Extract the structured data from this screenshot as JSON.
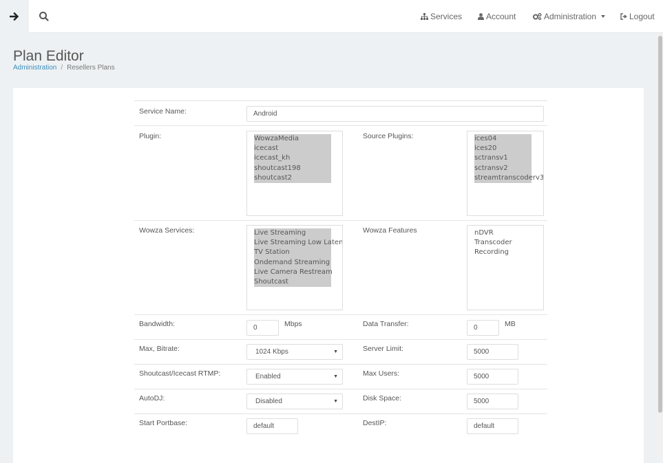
{
  "nav": {
    "services": "Services",
    "account": "Account",
    "administration": "Administration",
    "logout": "Logout"
  },
  "page": {
    "title": "Plan Editor",
    "breadcrumb": [
      "Administration",
      "Resellers Plans"
    ]
  },
  "form": {
    "service_name": {
      "label": "Service Name:",
      "value": "Android"
    },
    "plugin": {
      "label": "Plugin:",
      "options": [
        "WowzaMedia",
        "icecast",
        "icecast_kh",
        "shoutcast198",
        "shoutcast2"
      ]
    },
    "source_plugins": {
      "label": "Source Plugins:",
      "options": [
        "ices04",
        "ices20",
        "sctransv1",
        "sctransv2",
        "streamtranscoderv3"
      ]
    },
    "wowza_services": {
      "label": "Wowza Services:",
      "options": [
        "Live Streaming",
        "Live Streaming Low Latency",
        "TV Station",
        "Ondemand Streaming",
        "Live Camera Restream",
        "Shoutcast"
      ]
    },
    "wowza_features": {
      "label": "Wowza Features",
      "options": [
        "nDVR",
        "Transcoder",
        "Recording"
      ]
    },
    "bandwidth": {
      "label": "Bandwidth:",
      "value": "0",
      "unit": "Mbps"
    },
    "data_transfer": {
      "label": "Data Transfer:",
      "value": "0",
      "unit": "MB"
    },
    "max_bitrate": {
      "label": "Max, Bitrate:",
      "value": "1024 Kbps"
    },
    "server_limit": {
      "label": "Server Limit:",
      "value": "5000"
    },
    "shoutcast_rtmp": {
      "label": "Shoutcast/Icecast RTMP:",
      "value": "Enabled"
    },
    "max_users": {
      "label": "Max Users:",
      "value": "5000"
    },
    "autodj": {
      "label": "AutoDJ:",
      "value": "Disabled"
    },
    "disk_space": {
      "label": "Disk Space:",
      "value": "5000"
    },
    "start_portbase": {
      "label": "Start Portbase:",
      "value": "default"
    },
    "destip": {
      "label": "DestIP:",
      "value": "default"
    }
  },
  "colors": {
    "link": "#3c8dbc",
    "selected_option": "#cccccc"
  }
}
